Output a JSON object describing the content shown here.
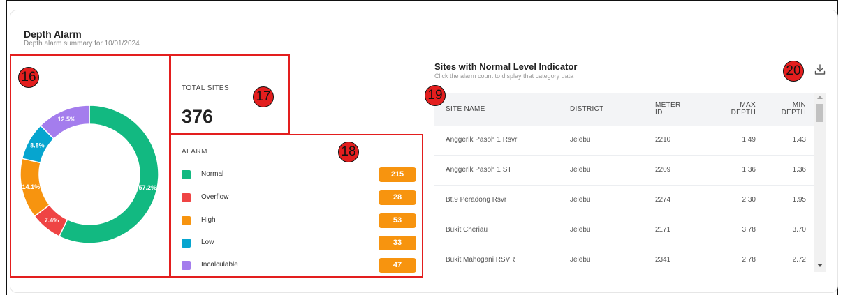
{
  "header": {
    "title": "Depth Alarm",
    "subtitle": "Depth alarm summary for 10/01/2024"
  },
  "badges": [
    "16",
    "17",
    "18",
    "19",
    "20"
  ],
  "chart_data": {
    "type": "pie",
    "variant": "donut",
    "slices": [
      {
        "name": "Normal",
        "value": 57.2,
        "label": "57.2%",
        "color": "#12b981"
      },
      {
        "name": "Overflow",
        "value": 7.4,
        "label": "7.4%",
        "color": "#ef4444"
      },
      {
        "name": "High",
        "value": 14.1,
        "label": "14.1%",
        "color": "#f7940f"
      },
      {
        "name": "Low",
        "value": 8.8,
        "label": "8.8%",
        "color": "#06a5cf"
      },
      {
        "name": "Incalculable",
        "value": 12.5,
        "label": "12.5%",
        "color": "#a47ded"
      }
    ],
    "start": "top, clockwise"
  },
  "total": {
    "label": "TOTAL SITES",
    "value": "376"
  },
  "alarm": {
    "title": "ALARM",
    "items": [
      {
        "name": "Normal",
        "count": "215",
        "color": "#12b981"
      },
      {
        "name": "Overflow",
        "count": "28",
        "color": "#ef4444"
      },
      {
        "name": "High",
        "count": "53",
        "color": "#f7940f"
      },
      {
        "name": "Low",
        "count": "33",
        "color": "#06a5cf"
      },
      {
        "name": "Incalculable",
        "count": "47",
        "color": "#a47ded"
      }
    ]
  },
  "sites": {
    "title": "Sites with Normal Level Indicator",
    "subtitle": "Click the alarm count to display that category data",
    "download_icon": "download-icon",
    "columns": {
      "site_name": "SITE NAME",
      "district": "DISTRICT",
      "meter_id_1": "METER",
      "meter_id_2": "ID",
      "max_depth_1": "MAX",
      "max_depth_2": "DEPTH",
      "min_depth_1": "MIN",
      "min_depth_2": "DEPTH"
    },
    "rows": [
      {
        "site": "Anggerik Pasoh 1 Rsvr",
        "district": "Jelebu",
        "meter": "2210",
        "max": "1.49",
        "min": "1.43"
      },
      {
        "site": "Anggerik Pasoh 1 ST",
        "district": "Jelebu",
        "meter": "2209",
        "max": "1.36",
        "min": "1.36"
      },
      {
        "site": "Bt.9 Peradong Rsvr",
        "district": "Jelebu",
        "meter": "2274",
        "max": "2.30",
        "min": "1.95"
      },
      {
        "site": "Bukit Cheriau",
        "district": "Jelebu",
        "meter": "2171",
        "max": "3.78",
        "min": "3.70"
      },
      {
        "site": "Bukit Mahogani RSVR",
        "district": "Jelebu",
        "meter": "2341",
        "max": "2.78",
        "min": "2.72"
      }
    ]
  }
}
